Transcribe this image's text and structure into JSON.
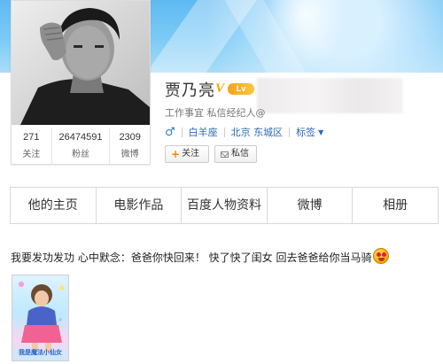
{
  "profile": {
    "name": "贾乃亮",
    "verified_badge": "V",
    "level_badge": "Lv",
    "verification": "工作事宜 私信经纪人@",
    "gender_symbol": "♂",
    "zodiac": "白羊座",
    "location": "北京 东城区",
    "tags_label": "标签",
    "tags_caret": "▼"
  },
  "stats": [
    {
      "value": "271",
      "label": "关注"
    },
    {
      "value": "26474591",
      "label": "粉丝"
    },
    {
      "value": "2309",
      "label": "微博"
    }
  ],
  "actions": {
    "follow_plus": "+",
    "follow_label": "关注",
    "message_label": "私信"
  },
  "tabs": [
    "他的主页",
    "电影作品",
    "百度人物资料",
    "微博",
    "相册"
  ],
  "post": {
    "text": "我要发功发功 心中默念：爸爸你快回来！ 快了快了闺女 回去爸爸给你当马骑",
    "emoji": "smile-emoji",
    "image_caption": "我是魔法小仙女"
  },
  "colors": {
    "cover": "#6cc1f4",
    "link": "#2b6bb8",
    "vip_gold": "#f2a800",
    "follow_plus": "#f28b00"
  }
}
